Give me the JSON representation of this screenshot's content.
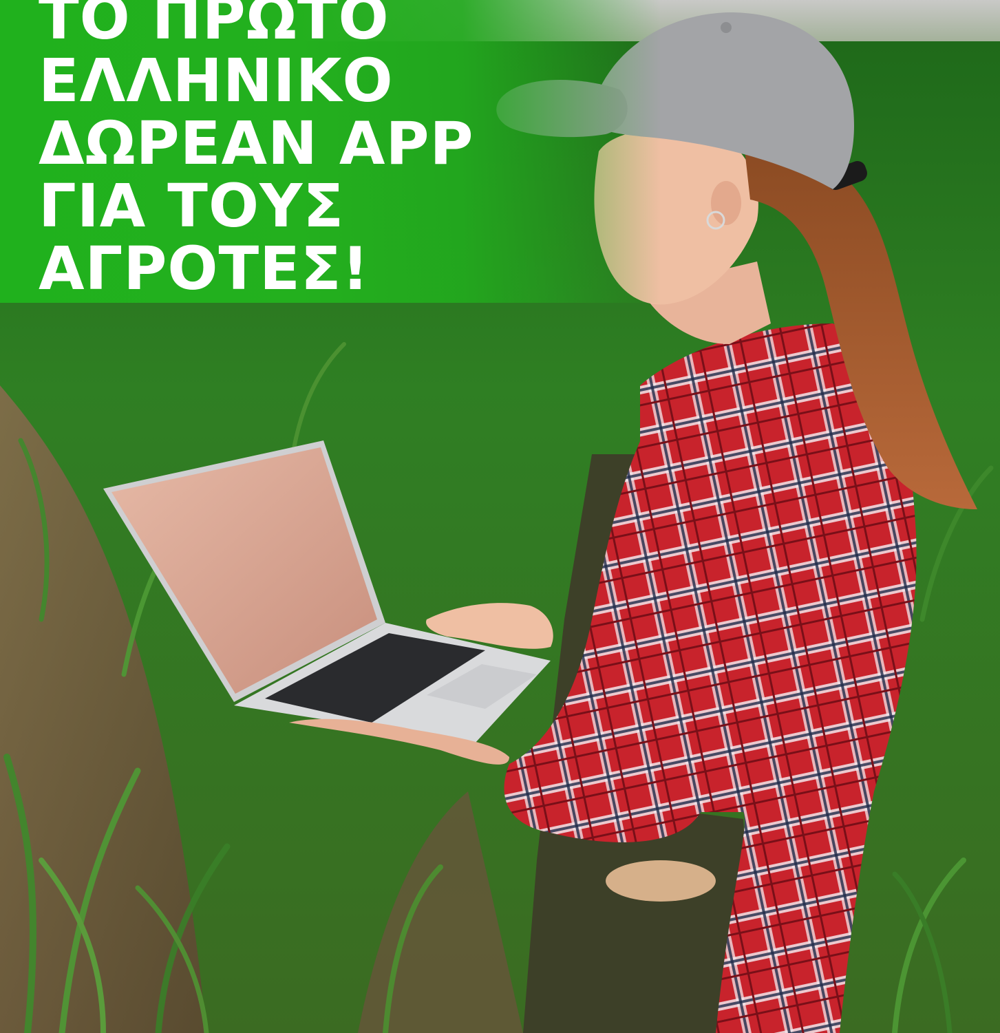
{
  "headline": {
    "lines": [
      "ΤΟ ΠΡΩΤΟ",
      "ΕΛΛΗΝΙΚΟ",
      "ΔΩΡΕΑΝ APP",
      "ΓΙΑ ΤΟΥΣ",
      "ΑΓΡΟΤΕΣ!"
    ]
  },
  "colors": {
    "banner_green": "#22b01e",
    "headline_text": "#ffffff",
    "field_green": "#2f7a26",
    "soil": "#7a5a44",
    "shirt_red": "#c8232c",
    "cap_grey": "#9fa0a3",
    "apron_olive": "#3d4028"
  },
  "photo": {
    "subject_icon": "farmer-with-laptop-photo"
  }
}
